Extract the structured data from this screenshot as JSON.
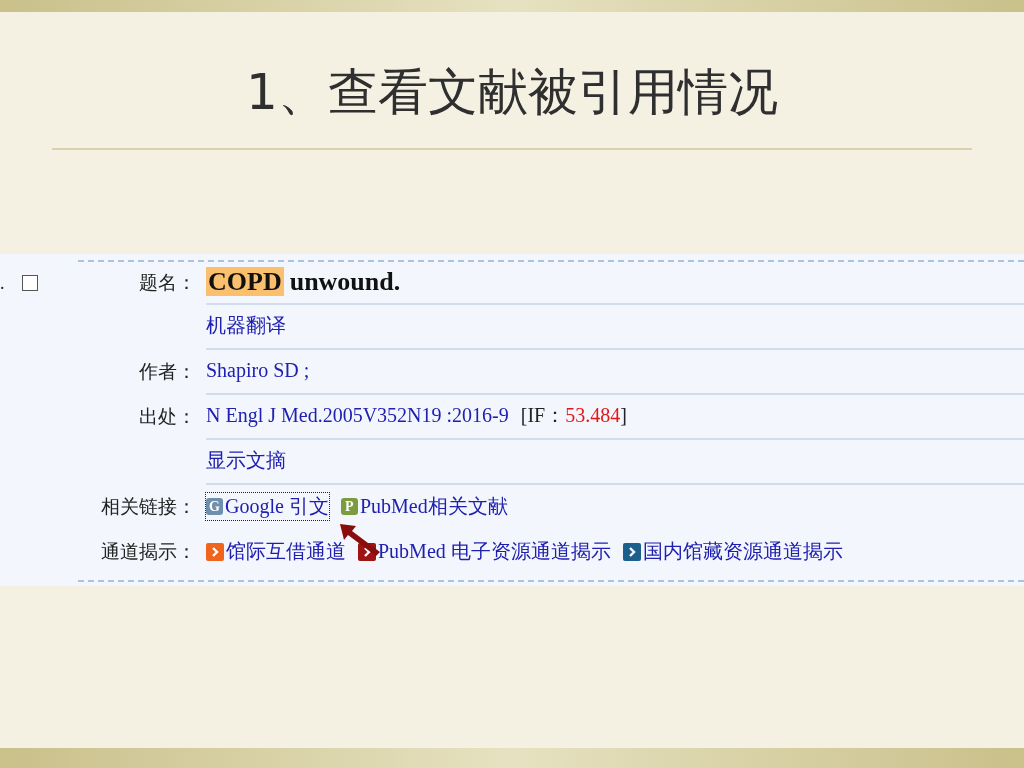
{
  "slide": {
    "title": "1、查看文献被引用情况"
  },
  "record": {
    "number": ".",
    "checked": false,
    "rows": [
      {
        "kind": "title",
        "label": "题名：",
        "highlight": "COPD",
        "text": "unwound."
      },
      {
        "kind": "link",
        "text": "机器翻译"
      },
      {
        "kind": "link",
        "label": "作者：",
        "text": "Shapiro SD ;"
      },
      {
        "kind": "source",
        "label": "出处：",
        "text": "N Engl J Med.2005V352N19 :2016-9",
        "if_label": "[IF：",
        "if_value": "53.484",
        "if_close": "]"
      },
      {
        "kind": "link",
        "text": "显示文摘"
      },
      {
        "kind": "badges",
        "label": "相关链接：",
        "items": [
          {
            "badge": "G",
            "color": "#6f8fae",
            "text": "Google 引文",
            "focused": true
          },
          {
            "badge": "P",
            "color": "#7c9a3e",
            "text": "PubMed相关文献",
            "focused": false
          }
        ]
      },
      {
        "kind": "channels",
        "label": "通道揭示：",
        "items": [
          {
            "color": "#f0641e",
            "text": "馆际互借通道"
          },
          {
            "color": "#9e1414",
            "text": "PubMed 电子资源通道揭示"
          },
          {
            "color": "#1d5f8c",
            "text": "国内馆藏资源通道揭示"
          }
        ]
      }
    ]
  }
}
